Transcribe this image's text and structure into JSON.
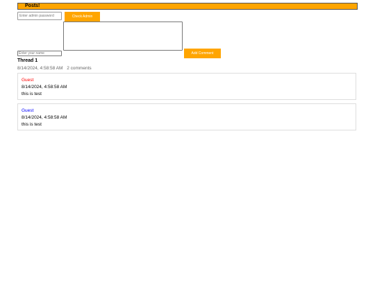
{
  "header": {
    "title": "Posts!",
    "bar_color": "#ffa500"
  },
  "admin": {
    "password_placeholder": "Enter admin password",
    "password_value": "",
    "check_button_label": "Check Admin"
  },
  "comment_form": {
    "textarea_value": "",
    "name_placeholder": "Enter your name",
    "name_value": "",
    "submit_label": "Add Comment"
  },
  "thread": {
    "title": "Thread 1",
    "timestamp": "8/14/2024, 4:58:58 AM",
    "comment_count": "2 comments",
    "comments": [
      {
        "author": "Guest",
        "author_color": "#ff0000",
        "timestamp": "8/14/2024, 4:58:58 AM",
        "text": "this is test"
      },
      {
        "author": "Guest",
        "author_color": "#0000ff",
        "timestamp": "8/14/2024, 4:58:58 AM",
        "text": "this is test"
      }
    ]
  }
}
